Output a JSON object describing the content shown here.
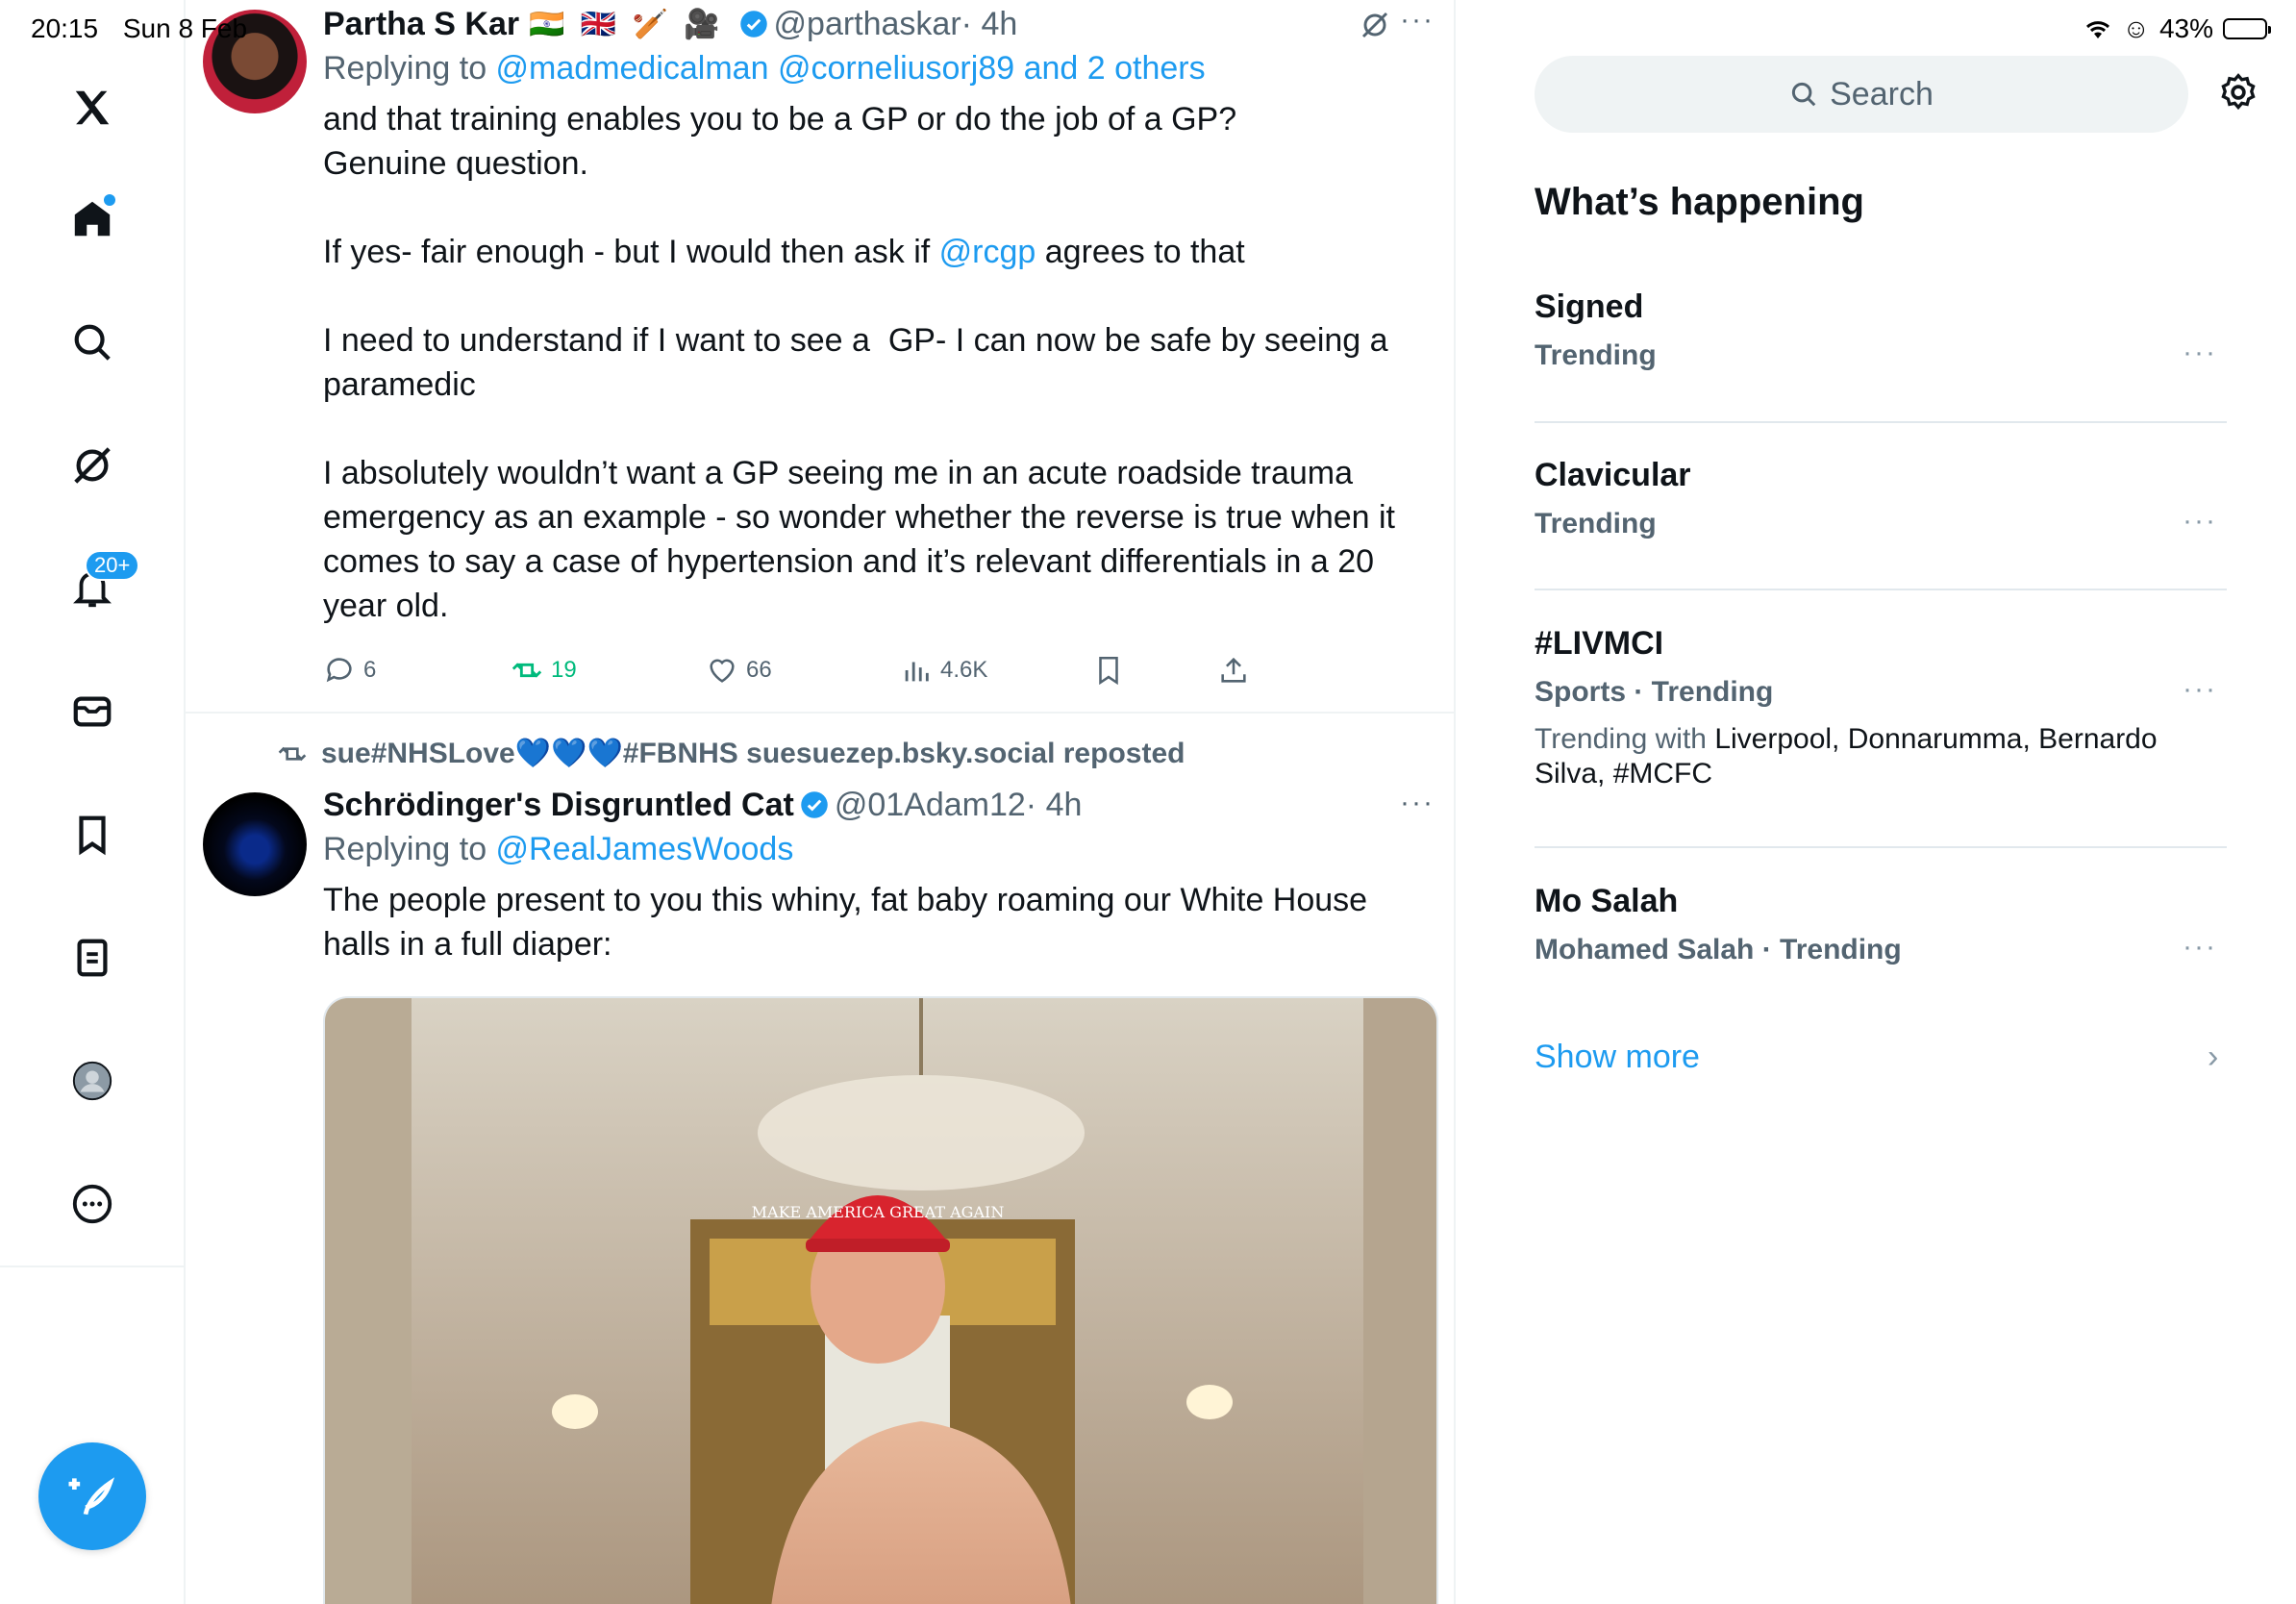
{
  "status_bar": {
    "time": "20:15",
    "date": "Sun 8 Feb",
    "battery": "43%"
  },
  "nav": {
    "notifications_badge": "20+",
    "items": [
      "x-logo",
      "home",
      "search",
      "grok",
      "notifications",
      "messages",
      "bookmarks",
      "lists",
      "profile",
      "more"
    ]
  },
  "tweets": [
    {
      "name": "Partha S Kar",
      "emojis": "🇮🇳 🇬🇧 🏏 🎥",
      "handle": "@parthaskar",
      "time": "· 4h",
      "replying_prefix": "Replying to ",
      "replying_to": "@madmedicalman @corneliusorj89 and 2 others",
      "text_part1": "and that training enables you to be a GP or do the job of a GP?\nGenuine question.\n\nIf yes- fair enough - but I would then ask if ",
      "mention": "@rcgp",
      "text_part2": " agrees to that\n\nI need to understand if I want to see a  GP- I can now be safe by seeing a paramedic\n\nI absolutely wouldn’t want a GP seeing me in an acute roadside trauma emergency as an example - so wonder whether the reverse is true when it comes to say a case of hypertension and it’s relevant differentials in a 20 year old.",
      "replies": "6",
      "reposts": "19",
      "likes": "66",
      "views": "4.6K"
    },
    {
      "repost_line": "sue#NHSLove💙💙💙#FBNHS suesuezep.bsky.social reposted",
      "name": "Schrödinger's Disgruntled Cat",
      "handle": "@01Adam12",
      "time": "· 4h",
      "replying_prefix": "Replying to ",
      "replying_to": "@RealJamesWoods",
      "text": "The people present to you this whiny, fat baby roaming our White House halls in a full diaper:",
      "hat_text": "MAKE AMERICA GREAT AGAIN"
    }
  ],
  "sidebar": {
    "search_placeholder": "Search",
    "title": "What’s happening",
    "trends": [
      {
        "title": "Signed",
        "meta": "Trending"
      },
      {
        "title": "Clavicular",
        "meta": "Trending"
      },
      {
        "title": "#LIVMCI",
        "meta": "Sports · Trending",
        "with_prefix": "Trending with ",
        "with_items": "Liverpool, Donnarumma, Bernardo Silva, #MCFC"
      },
      {
        "title": "Mo Salah",
        "meta": "Mohamed Salah · Trending"
      }
    ],
    "show_more": "Show more"
  },
  "colors": {
    "accent": "#1d9bf0",
    "repost": "#00ba7c",
    "muted": "#536471"
  }
}
